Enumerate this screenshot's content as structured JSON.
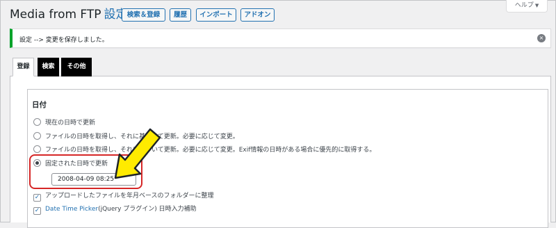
{
  "header": {
    "title": "Media from FTP",
    "settings": "設定",
    "buttons": [
      "検索＆登録",
      "履歴",
      "インポート",
      "アドオン"
    ],
    "help": "ヘルプ",
    "help_caret": "▼"
  },
  "notice": {
    "text": "設定 --> 変更を保存しました。",
    "dismiss": "×"
  },
  "tabs": [
    "登録",
    "検索",
    "その他"
  ],
  "section": {
    "title": "日付",
    "options": [
      "現在の日時で更新",
      "ファイルの日時を取得し、それに基づいて更新。必要に応じて変更。",
      "ファイルの日時を取得し、それに基づいて更新。必要に応じて変更。Exif情報の日時がある場合に優先的に取得する。",
      "固定された日時で更新"
    ],
    "selected_option": 3,
    "datetime_value": "2008-04-09 08:25",
    "checkbox_folder": "アップロードしたファイルを年月ベースのフォルダーに整理",
    "checkbox_picker_link": "Date Time Picker",
    "checkbox_picker_text": "(jQuery プラグイン) 日時入力補助"
  },
  "colors": {
    "accent": "#2271b1",
    "success": "#00a32a",
    "annotation_red": "#d62626",
    "arrow_yellow": "#ffeb00"
  },
  "icons": [
    "close-icon",
    "chevron-down-icon",
    "arrow-annotation-icon"
  ]
}
